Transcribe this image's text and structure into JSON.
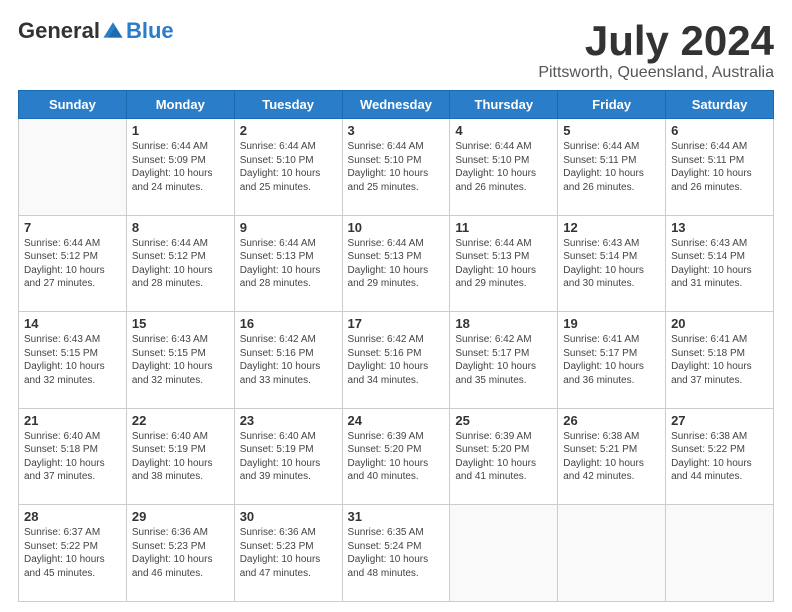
{
  "header": {
    "logo_general": "General",
    "logo_blue": "Blue",
    "month_title": "July 2024",
    "location": "Pittsworth, Queensland, Australia"
  },
  "days_of_week": [
    "Sunday",
    "Monday",
    "Tuesday",
    "Wednesday",
    "Thursday",
    "Friday",
    "Saturday"
  ],
  "weeks": [
    [
      {
        "day": "",
        "content": ""
      },
      {
        "day": "1",
        "content": "Sunrise: 6:44 AM\nSunset: 5:09 PM\nDaylight: 10 hours\nand 24 minutes."
      },
      {
        "day": "2",
        "content": "Sunrise: 6:44 AM\nSunset: 5:10 PM\nDaylight: 10 hours\nand 25 minutes."
      },
      {
        "day": "3",
        "content": "Sunrise: 6:44 AM\nSunset: 5:10 PM\nDaylight: 10 hours\nand 25 minutes."
      },
      {
        "day": "4",
        "content": "Sunrise: 6:44 AM\nSunset: 5:10 PM\nDaylight: 10 hours\nand 26 minutes."
      },
      {
        "day": "5",
        "content": "Sunrise: 6:44 AM\nSunset: 5:11 PM\nDaylight: 10 hours\nand 26 minutes."
      },
      {
        "day": "6",
        "content": "Sunrise: 6:44 AM\nSunset: 5:11 PM\nDaylight: 10 hours\nand 26 minutes."
      }
    ],
    [
      {
        "day": "7",
        "content": "Sunrise: 6:44 AM\nSunset: 5:12 PM\nDaylight: 10 hours\nand 27 minutes."
      },
      {
        "day": "8",
        "content": "Sunrise: 6:44 AM\nSunset: 5:12 PM\nDaylight: 10 hours\nand 28 minutes."
      },
      {
        "day": "9",
        "content": "Sunrise: 6:44 AM\nSunset: 5:13 PM\nDaylight: 10 hours\nand 28 minutes."
      },
      {
        "day": "10",
        "content": "Sunrise: 6:44 AM\nSunset: 5:13 PM\nDaylight: 10 hours\nand 29 minutes."
      },
      {
        "day": "11",
        "content": "Sunrise: 6:44 AM\nSunset: 5:13 PM\nDaylight: 10 hours\nand 29 minutes."
      },
      {
        "day": "12",
        "content": "Sunrise: 6:43 AM\nSunset: 5:14 PM\nDaylight: 10 hours\nand 30 minutes."
      },
      {
        "day": "13",
        "content": "Sunrise: 6:43 AM\nSunset: 5:14 PM\nDaylight: 10 hours\nand 31 minutes."
      }
    ],
    [
      {
        "day": "14",
        "content": "Sunrise: 6:43 AM\nSunset: 5:15 PM\nDaylight: 10 hours\nand 32 minutes."
      },
      {
        "day": "15",
        "content": "Sunrise: 6:43 AM\nSunset: 5:15 PM\nDaylight: 10 hours\nand 32 minutes."
      },
      {
        "day": "16",
        "content": "Sunrise: 6:42 AM\nSunset: 5:16 PM\nDaylight: 10 hours\nand 33 minutes."
      },
      {
        "day": "17",
        "content": "Sunrise: 6:42 AM\nSunset: 5:16 PM\nDaylight: 10 hours\nand 34 minutes."
      },
      {
        "day": "18",
        "content": "Sunrise: 6:42 AM\nSunset: 5:17 PM\nDaylight: 10 hours\nand 35 minutes."
      },
      {
        "day": "19",
        "content": "Sunrise: 6:41 AM\nSunset: 5:17 PM\nDaylight: 10 hours\nand 36 minutes."
      },
      {
        "day": "20",
        "content": "Sunrise: 6:41 AM\nSunset: 5:18 PM\nDaylight: 10 hours\nand 37 minutes."
      }
    ],
    [
      {
        "day": "21",
        "content": "Sunrise: 6:40 AM\nSunset: 5:18 PM\nDaylight: 10 hours\nand 37 minutes."
      },
      {
        "day": "22",
        "content": "Sunrise: 6:40 AM\nSunset: 5:19 PM\nDaylight: 10 hours\nand 38 minutes."
      },
      {
        "day": "23",
        "content": "Sunrise: 6:40 AM\nSunset: 5:19 PM\nDaylight: 10 hours\nand 39 minutes."
      },
      {
        "day": "24",
        "content": "Sunrise: 6:39 AM\nSunset: 5:20 PM\nDaylight: 10 hours\nand 40 minutes."
      },
      {
        "day": "25",
        "content": "Sunrise: 6:39 AM\nSunset: 5:20 PM\nDaylight: 10 hours\nand 41 minutes."
      },
      {
        "day": "26",
        "content": "Sunrise: 6:38 AM\nSunset: 5:21 PM\nDaylight: 10 hours\nand 42 minutes."
      },
      {
        "day": "27",
        "content": "Sunrise: 6:38 AM\nSunset: 5:22 PM\nDaylight: 10 hours\nand 44 minutes."
      }
    ],
    [
      {
        "day": "28",
        "content": "Sunrise: 6:37 AM\nSunset: 5:22 PM\nDaylight: 10 hours\nand 45 minutes."
      },
      {
        "day": "29",
        "content": "Sunrise: 6:36 AM\nSunset: 5:23 PM\nDaylight: 10 hours\nand 46 minutes."
      },
      {
        "day": "30",
        "content": "Sunrise: 6:36 AM\nSunset: 5:23 PM\nDaylight: 10 hours\nand 47 minutes."
      },
      {
        "day": "31",
        "content": "Sunrise: 6:35 AM\nSunset: 5:24 PM\nDaylight: 10 hours\nand 48 minutes."
      },
      {
        "day": "",
        "content": ""
      },
      {
        "day": "",
        "content": ""
      },
      {
        "day": "",
        "content": ""
      }
    ]
  ]
}
